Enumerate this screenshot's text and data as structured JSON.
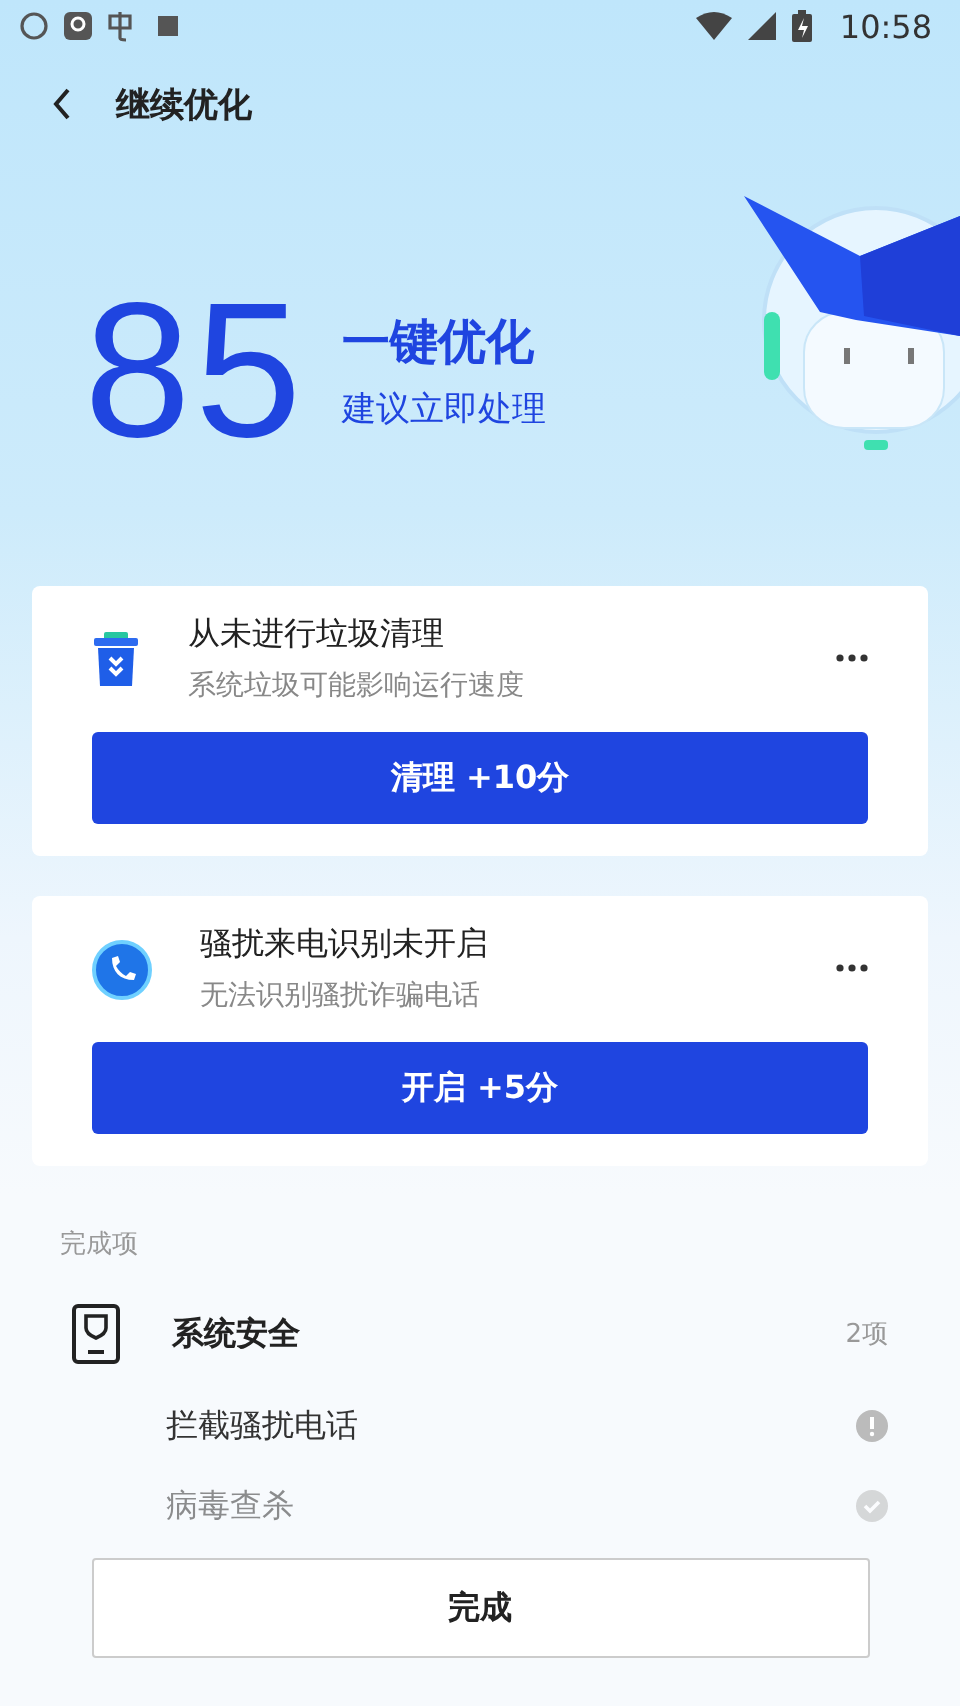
{
  "status_bar": {
    "time": "10:58"
  },
  "header": {
    "title": "继续优化"
  },
  "hero": {
    "score": "85",
    "title": "一键优化",
    "subtitle": "建议立即处理"
  },
  "tasks": [
    {
      "kind": "trash",
      "title": "从未进行垃圾清理",
      "description": "系统垃圾可能影响运行速度",
      "action": "清理 +10分"
    },
    {
      "kind": "phone",
      "title": "骚扰来电识别未开启",
      "description": "无法识别骚扰诈骗电话",
      "action": "开启 +5分"
    }
  ],
  "completed": {
    "label": "完成项",
    "groups": [
      {
        "title": "系统安全",
        "count": "2项",
        "items": [
          {
            "label": "拦截骚扰电话",
            "kind": "warning"
          },
          {
            "label": "病毒查杀",
            "kind": "ok"
          }
        ]
      }
    ]
  },
  "footer": {
    "button": "完成"
  }
}
